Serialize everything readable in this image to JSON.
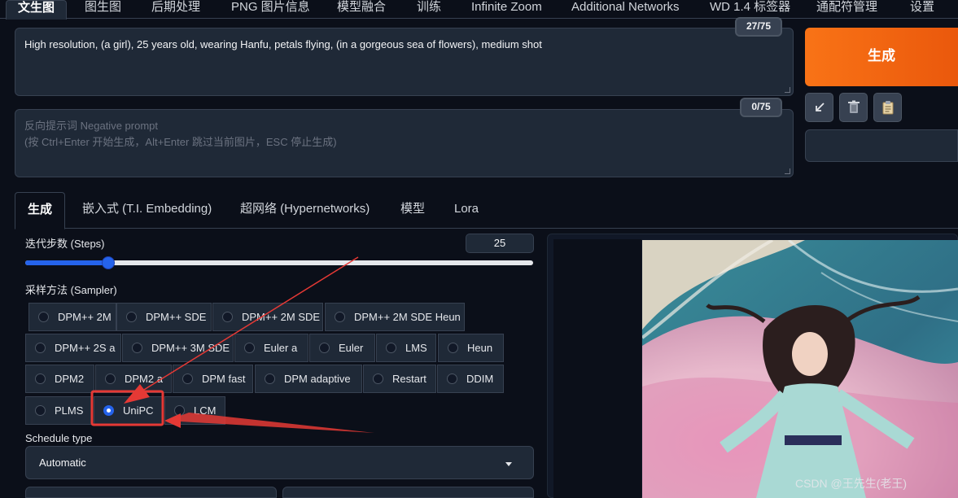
{
  "top_tabs": [
    "文生图",
    "图生图",
    "后期处理",
    "PNG 图片信息",
    "模型融合",
    "训练",
    "Infinite Zoom",
    "Additional Networks",
    "WD 1.4 标签器",
    "通配符管理",
    "设置"
  ],
  "prompt": {
    "positive_text": "High resolution, (a girl), 25 years old, wearing Hanfu, petals flying, (in a gorgeous sea of flowers), medium shot",
    "positive_counter": "27/75",
    "negative_placeholder_line1": "反向提示词 Negative prompt",
    "negative_placeholder_line2": "(按 Ctrl+Enter 开始生成，Alt+Enter 跳过当前图片，ESC 停止生成)",
    "negative_counter": "0/75"
  },
  "generate_label": "生成",
  "tool_icons": [
    "arrow-icon",
    "trash-icon",
    "clipboard-icon"
  ],
  "settings_tabs": [
    "生成",
    "嵌入式 (T.I. Embedding)",
    "超网络 (Hypernetworks)",
    "模型",
    "Lora"
  ],
  "steps": {
    "label": "迭代步数 (Steps)",
    "value": "25",
    "min": 1,
    "max": 150,
    "current": 25
  },
  "sampler": {
    "label": "采样方法 (Sampler)",
    "selected": "UniPC",
    "options": [
      "DPM++ 2M",
      "DPM++ SDE",
      "DPM++ 2M SDE",
      "DPM++ 2M SDE Heun",
      "DPM++ 2S a",
      "DPM++ 3M SDE",
      "Euler a",
      "Euler",
      "LMS",
      "Heun",
      "DPM2",
      "DPM2 a",
      "DPM fast",
      "DPM adaptive",
      "Restart",
      "DDIM",
      "PLMS",
      "UniPC",
      "LCM"
    ]
  },
  "schedule": {
    "label": "Schedule type",
    "value": "Automatic"
  },
  "watermark": "CSDN @王先生(老王)",
  "colors": {
    "accent": "#2563eb",
    "generate": "#f97316",
    "annotation": "#e53935"
  }
}
